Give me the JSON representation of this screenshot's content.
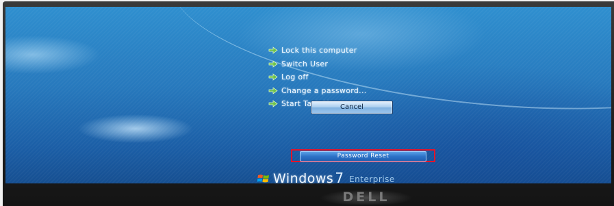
{
  "menu": {
    "items": [
      {
        "label": "Lock this computer"
      },
      {
        "label": "Switch User"
      },
      {
        "label": "Log off"
      },
      {
        "label": "Change a password..."
      },
      {
        "label": "Start Task Manager"
      }
    ]
  },
  "buttons": {
    "cancel_label": "Cancel",
    "password_reset_label": "Password Reset"
  },
  "branding": {
    "windows_brand": "Windows",
    "windows_version": "7",
    "windows_edition": "Enterprise",
    "monitor_brand": "DELL"
  },
  "colors": {
    "background_blue": "#2779bd",
    "menu_text": "#eaf6ff",
    "arrow_green": "#6cc24a",
    "highlight_red": "#e4142a"
  },
  "icons": {
    "menu_item_icon": "green-arrow-icon",
    "windows_logo": "windows-flag-icon"
  }
}
